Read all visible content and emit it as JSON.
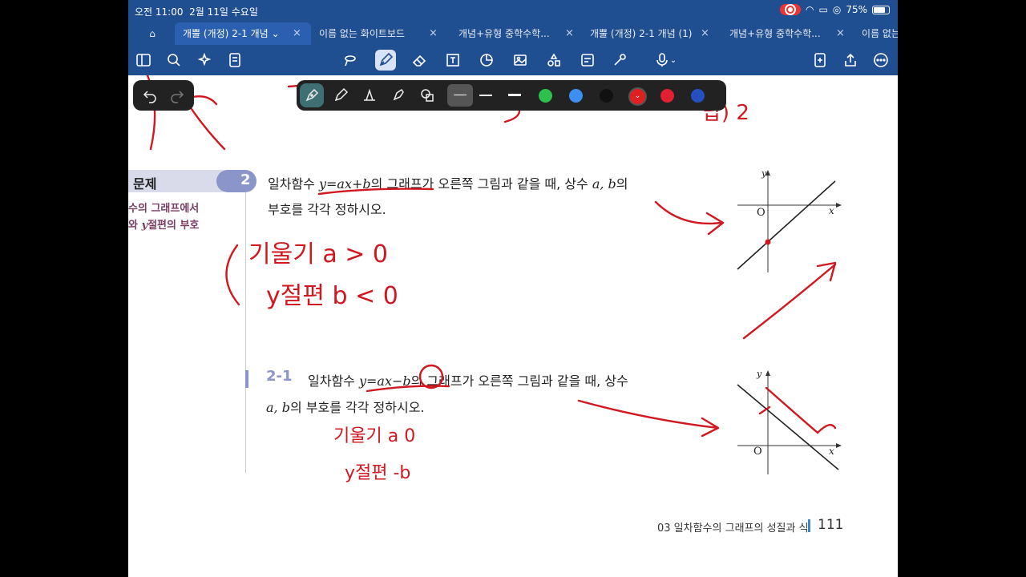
{
  "status": {
    "time": "오전 11:00",
    "date": "2월 11일 수요일",
    "battery": "75%"
  },
  "tabs": [
    {
      "label": "개뿔 (개정) 2-1 개념 ⌄"
    },
    {
      "label": "이름 없는 화이트보드"
    },
    {
      "label": "개념+유형 중학수학..."
    },
    {
      "label": "개뿔 (개정) 2-1 개념 (1)"
    },
    {
      "label": "개념+유형 중학수학..."
    },
    {
      "label": "이름 없는"
    }
  ],
  "close": "×",
  "page": {
    "side_heading": "문제",
    "side_note1": "수의 그래프에서",
    "side_note2_pre": "와 ",
    "side_note2_it": "y",
    "side_note2_post": "절편의 부호",
    "p2": {
      "badge": "2",
      "line1_pre": "일차함수 ",
      "line1_eq": "y=ax+b",
      "line1_post": "의 그래프가 오른쪽 그림과 같을 때, 상수 ",
      "line1_vars": "a, b",
      "line1_end": "의",
      "line2": "부호를 각각 정하시오."
    },
    "p21": {
      "badge": "2-1",
      "line1_pre": "일차함수 ",
      "line1_eq": "y=ax−b",
      "line1_post": "의 그래프가 오른쪽 그림과 같을 때, 상수",
      "line2_vars": "a, b",
      "line2_post": "의 부호를 각각 정하시오."
    },
    "graph_labels": {
      "y": "y",
      "x": "x",
      "o": "O"
    },
    "footer_chapter": "03 일차함수의 그래프의 성질과 식",
    "footer_page": "111"
  },
  "ink": {
    "top_scribble": "답) 2",
    "note1": "기울기 a > 0",
    "note2": "y절편 b < 0",
    "note3": "기울기 a   0",
    "note4": "y절편  -b"
  },
  "colors": {
    "accent": "#1f4e91",
    "ink": "#d01820",
    "badge": "#8c95c9"
  }
}
